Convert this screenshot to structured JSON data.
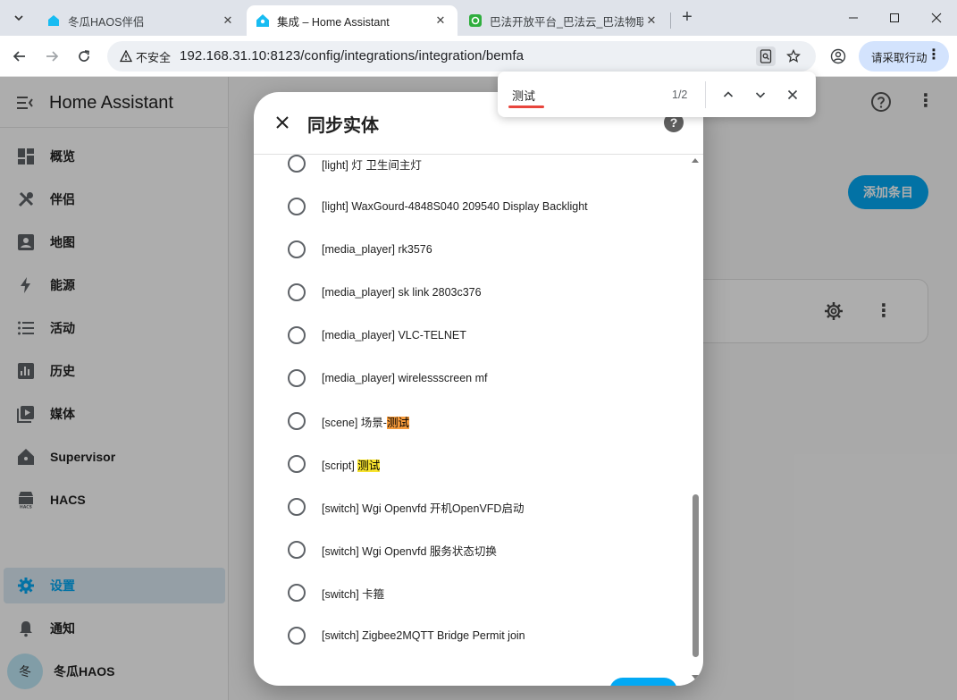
{
  "browser": {
    "tabs": [
      {
        "title": "冬瓜HAOS伴侣",
        "active": false
      },
      {
        "title": "集成 – Home Assistant",
        "active": true
      },
      {
        "title": "巴法开放平台_巴法云_巴法物联",
        "active": false
      }
    ],
    "security_label": "不安全",
    "url": "192.168.31.10:8123/config/integrations/integration/bemfa",
    "action_button": "请采取行动"
  },
  "find_bar": {
    "query": "测试",
    "count": "1/2"
  },
  "sidebar": {
    "title": "Home Assistant",
    "items": [
      {
        "label": "概览",
        "icon": "dashboard-icon"
      },
      {
        "label": "伴侣",
        "icon": "tools-icon"
      },
      {
        "label": "地图",
        "icon": "map-icon"
      },
      {
        "label": "能源",
        "icon": "lightning-icon"
      },
      {
        "label": "活动",
        "icon": "list-icon"
      },
      {
        "label": "历史",
        "icon": "chart-icon"
      },
      {
        "label": "媒体",
        "icon": "media-icon"
      },
      {
        "label": "Supervisor",
        "icon": "home-assistant-icon"
      },
      {
        "label": "HACS",
        "icon": "hacs-icon"
      }
    ],
    "settings_label": "设置",
    "notifications_label": "通知",
    "user_initial": "冬",
    "user_name": "冬瓜HAOS"
  },
  "main": {
    "add_entry_label": "添加条目"
  },
  "dialog": {
    "title": "同步实体",
    "options": [
      {
        "pre": "[light] 灯 卫生间主灯",
        "hl": "",
        "post": ""
      },
      {
        "pre": "[light] WaxGourd-4848S040 209540 Display Backlight",
        "hl": "",
        "post": ""
      },
      {
        "pre": "[media_player] rk3576",
        "hl": "",
        "post": ""
      },
      {
        "pre": "[media_player] sk link 2803c376",
        "hl": "",
        "post": ""
      },
      {
        "pre": "[media_player] VLC-TELNET",
        "hl": "",
        "post": ""
      },
      {
        "pre": "[media_player] wirelessscreen mf",
        "hl": "",
        "post": ""
      },
      {
        "pre": "[scene] 场景-",
        "hl": "测试",
        "post": "",
        "current": true
      },
      {
        "pre": "[script] ",
        "hl": "测试",
        "post": ""
      },
      {
        "pre": "[switch] Wgi Openvfd 开机OpenVFD启动",
        "hl": "",
        "post": ""
      },
      {
        "pre": "[switch] Wgi Openvfd 服务状态切换",
        "hl": "",
        "post": ""
      },
      {
        "pre": "[switch] 卡箍",
        "hl": "",
        "post": ""
      },
      {
        "pre": "[switch] Zigbee2MQTT Bridge Permit join",
        "hl": "",
        "post": ""
      }
    ]
  },
  "colors": {
    "accent": "#03a9f4",
    "find_highlight": "#f7e32e",
    "find_current": "#f59a3b"
  }
}
